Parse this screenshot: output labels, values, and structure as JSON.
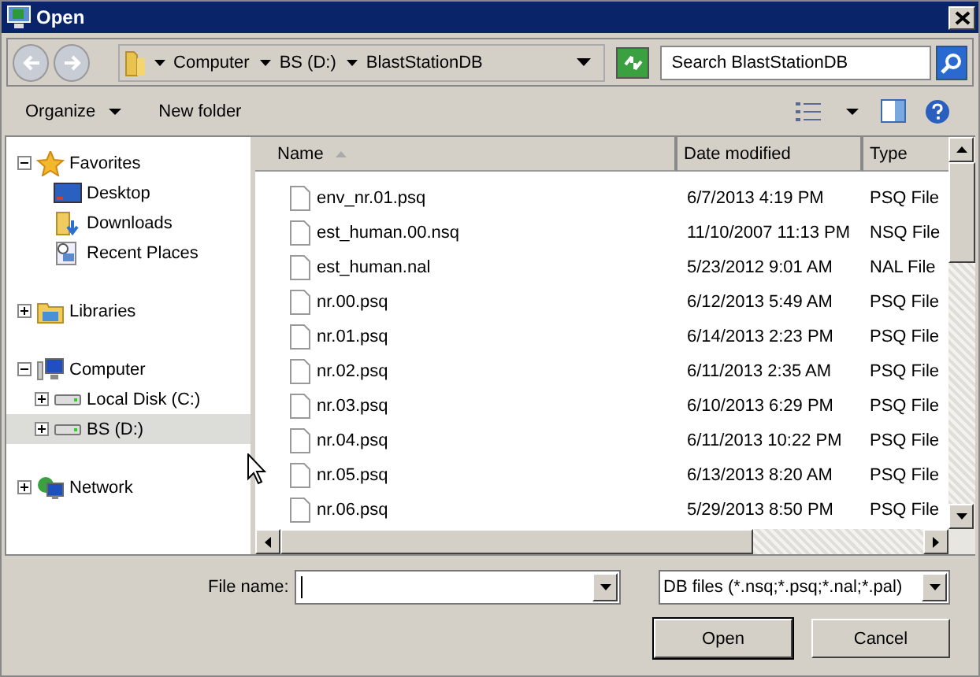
{
  "window": {
    "title": "Open"
  },
  "address": {
    "path": [
      "Computer",
      "BS (D:)",
      "BlastStationDB"
    ]
  },
  "search": {
    "placeholder": "Search BlastStationDB"
  },
  "toolbar": {
    "items": [
      "Organize",
      "New folder"
    ]
  },
  "sidebar": {
    "items": [
      {
        "label": "Favorites",
        "expanded": true,
        "selected": false,
        "children": [
          {
            "label": "Desktop",
            "selected": false
          },
          {
            "label": "Downloads",
            "selected": false
          },
          {
            "label": "Recent Places",
            "selected": false
          }
        ]
      },
      {
        "label": "Libraries",
        "expanded": false,
        "selected": false
      },
      {
        "label": "Computer",
        "expanded": true,
        "selected": false,
        "children": [
          {
            "label": "Local Disk (C:)",
            "expanded": false,
            "selected": false
          },
          {
            "label": "BS (D:)",
            "expanded": false,
            "selected": true
          }
        ]
      },
      {
        "label": "Network",
        "expanded": false,
        "selected": false
      }
    ]
  },
  "table": {
    "columns": [
      "Name",
      "Date modified",
      "Type"
    ],
    "rows": [
      [
        "env_nr.01.psq",
        "6/7/2013 4:19 PM",
        "PSQ File"
      ],
      [
        "est_human.00.nsq",
        "11/10/2007 11:13 PM",
        "NSQ File"
      ],
      [
        "est_human.nal",
        "5/23/2012 9:01 AM",
        "NAL File"
      ],
      [
        "nr.00.psq",
        "6/12/2013 5:49 AM",
        "PSQ File"
      ],
      [
        "nr.01.psq",
        "6/14/2013 2:23 PM",
        "PSQ File"
      ],
      [
        "nr.02.psq",
        "6/11/2013 2:35 AM",
        "PSQ File"
      ],
      [
        "nr.03.psq",
        "6/10/2013 6:29 PM",
        "PSQ File"
      ],
      [
        "nr.04.psq",
        "6/11/2013 10:22 PM",
        "PSQ File"
      ],
      [
        "nr.05.psq",
        "6/13/2013 8:20 AM",
        "PSQ File"
      ],
      [
        "nr.06.psq",
        "5/29/2013 8:50 PM",
        "PSQ File"
      ]
    ]
  },
  "file_name": {
    "label": "File name:"
  },
  "file_type": {
    "value": "DB files (*.nsq;*.psq;*.nal;*.pal)"
  },
  "buttons": [
    "Open",
    "Cancel"
  ]
}
